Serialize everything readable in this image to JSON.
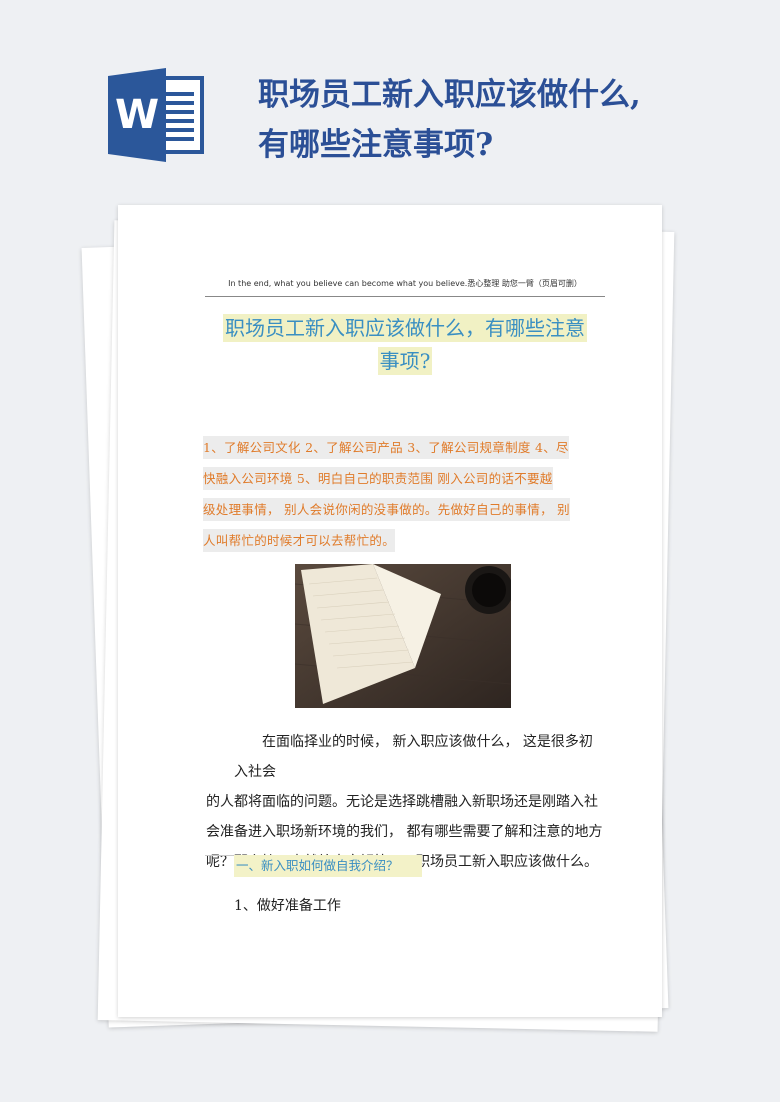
{
  "header": {
    "title_line1": "职场员工新入职应该做什么,",
    "title_line2": "有哪些注意事项?"
  },
  "icon": {
    "name": "word-icon",
    "letter": "W",
    "brand_color": "#2b579a"
  },
  "document": {
    "page_header": "In the end, what you believe can become what you believe.悉心整理   助您一臂（页眉可删）",
    "title_line1": "职场员工新入职应该做什么，有哪些注意",
    "title_line2": "事项?",
    "intro_lines": [
      "1、了解公司文化 2、了解公司产品 3、了解公司规章制度 4、尽",
      "快融入公司环境 5、明白自己的职责范围  刚入公司的话不要越",
      "级处理事情，  别人会说你闲的没事做的。先做好自己的事情，  别",
      "人叫帮忙的时候才可以去帮忙的。"
    ],
    "body_lines": [
      "在面临择业的时候，  新入职应该做什么，  这是很多初入社会",
      "的人都将面临的问题。无论是选择跳槽融入新职场还是刚踏入社",
      "会准备进入职场新环境的我们，  都有哪些需要了解和注意的地方",
      "呢？那么接下来就给大家解答一下职场员工新入职应该做什么。"
    ],
    "section_heading": "一、新入职如何做自我介绍？",
    "sub_item": "1、做好准备工作"
  },
  "colors": {
    "title_blue": "#2b4f96",
    "heading_blue": "#3a8fc2",
    "intro_orange": "#e07b2a",
    "highlight_yellow": "#f1f1c4"
  }
}
